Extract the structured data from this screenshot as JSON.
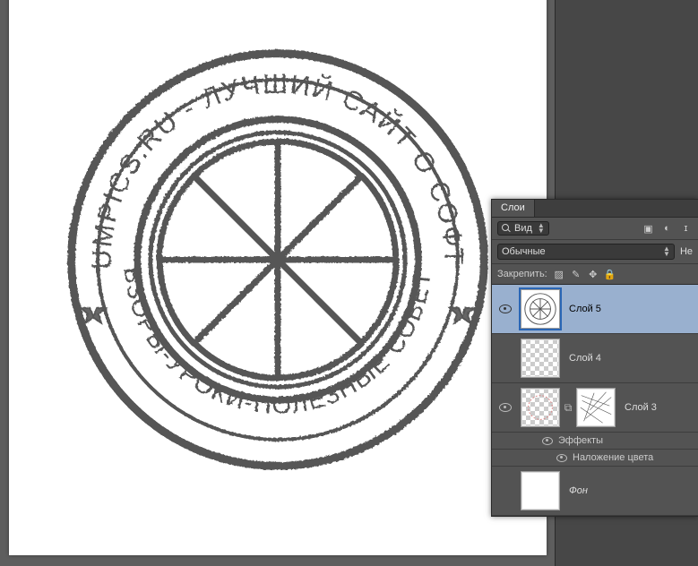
{
  "panel": {
    "tab_layers": "Слои",
    "filter_label": "Вид",
    "blend_label": "Обычные",
    "opacity_label_short": "Не",
    "lock_label": "Закрепить:"
  },
  "layers": {
    "0": {
      "name": "Слой 5"
    },
    "1": {
      "name": "Слой 4"
    },
    "2": {
      "name": "Слой 3"
    },
    "fx_label": "Эффекты",
    "fx_overlay": "Наложение цвета",
    "bg": {
      "name": "Фон"
    }
  },
  "stamp": {
    "top_text": "LUMPICS.RU - ЛУЧШИЙ САЙТ О СОФТЕ",
    "bottom_text": "ОБЗОРЫ-УРОКИ-ПОЛЕЗНЫЕ СОВЕТЫ"
  }
}
